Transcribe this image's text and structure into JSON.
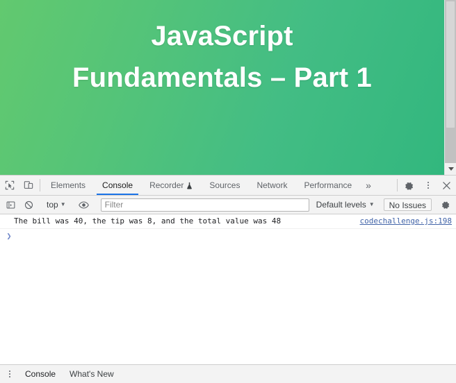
{
  "page": {
    "title_line1": "JavaScript",
    "title_line2": "Fundamentals – Part 1",
    "hero_gradient_start": "#62c96f",
    "hero_gradient_end": "#32b77e"
  },
  "scrollbar": {
    "name": "page-vertical-scrollbar",
    "down_arrow": "▼"
  },
  "devtools": {
    "icons": {
      "inspect": "inspect-element-icon",
      "device": "device-toolbar-icon",
      "settings": "gear-icon",
      "kebab": "more-options-icon",
      "close": "close-icon",
      "overflow": "»"
    },
    "tabs": [
      {
        "label": "Elements",
        "active": false,
        "badge": ""
      },
      {
        "label": "Console",
        "active": true,
        "badge": ""
      },
      {
        "label": "Recorder",
        "active": false,
        "badge": "experiment-flask-icon"
      },
      {
        "label": "Sources",
        "active": false,
        "badge": ""
      },
      {
        "label": "Network",
        "active": false,
        "badge": ""
      },
      {
        "label": "Performance",
        "active": false,
        "badge": ""
      }
    ],
    "console_toolbar": {
      "sidebar_toggle": "console-sidebar-toggle-icon",
      "clear_console": "clear-console-icon",
      "context": "top",
      "context_caret": "▼",
      "live_expression": "eye-icon",
      "filter_placeholder": "Filter",
      "filter_value": "",
      "levels_label": "Default levels",
      "levels_caret": "▼",
      "issues_label": "No Issues",
      "settings": "gear-icon"
    },
    "console_messages": [
      {
        "text": "The bill was 40, the tip was 8, and the total value was 48",
        "source": "codechallenge.js:198"
      }
    ],
    "prompt": {
      "caret": "❯",
      "value": ""
    },
    "drawer_tabs": [
      {
        "label": "Console",
        "active": true
      },
      {
        "label": "What's New",
        "active": false
      }
    ]
  }
}
